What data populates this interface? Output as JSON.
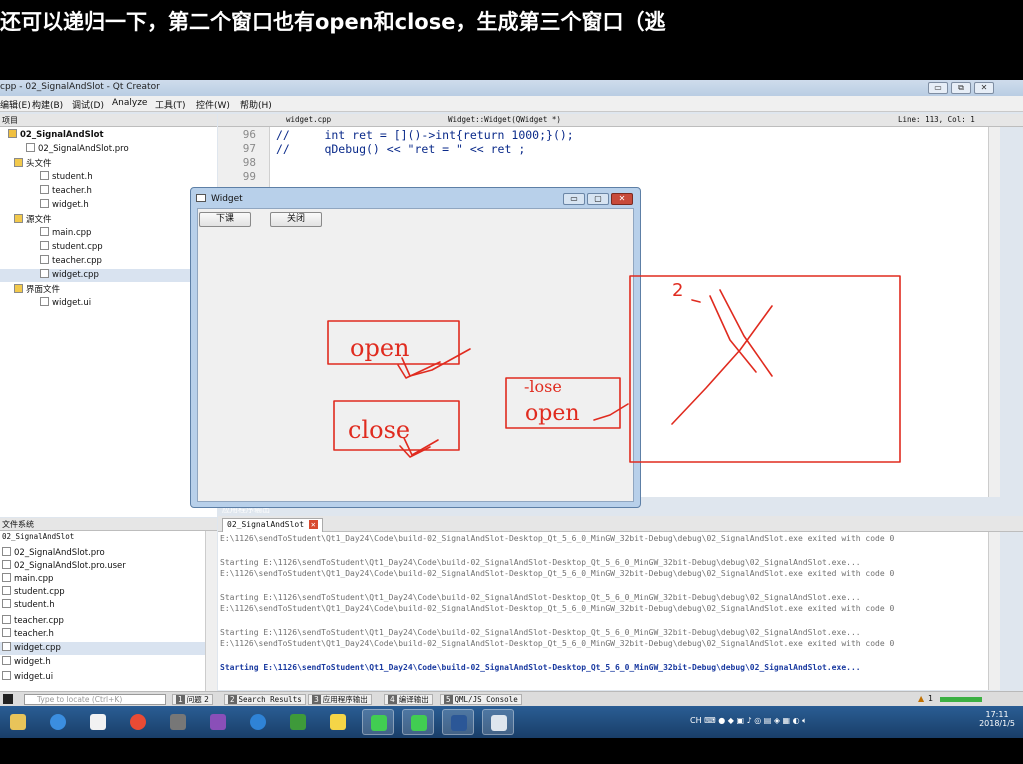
{
  "subtitle": "还可以递归一下，第二个窗口也有open和close，生成第三个窗口（逃",
  "window": {
    "title": "cpp - 02_SignalAndSlot - Qt Creator"
  },
  "menu": [
    "编辑(E)",
    "构建(B)",
    "调试(D)",
    "Analyze",
    "工具(T)",
    "控件(W)",
    "帮助(H)"
  ],
  "project_panel": {
    "header": "项目",
    "items": [
      {
        "label": "02_SignalAndSlot",
        "indent": 0
      },
      {
        "label": "02_SignalAndSlot.pro",
        "indent": 1
      },
      {
        "label": "头文件",
        "indent": 1
      },
      {
        "label": "student.h",
        "indent": 2
      },
      {
        "label": "teacher.h",
        "indent": 2
      },
      {
        "label": "widget.h",
        "indent": 2
      },
      {
        "label": "源文件",
        "indent": 1
      },
      {
        "label": "main.cpp",
        "indent": 2
      },
      {
        "label": "student.cpp",
        "indent": 2
      },
      {
        "label": "teacher.cpp",
        "indent": 2
      },
      {
        "label": "widget.cpp",
        "indent": 2
      },
      {
        "label": "界面文件",
        "indent": 1
      },
      {
        "label": "widget.ui",
        "indent": 2
      }
    ]
  },
  "editor": {
    "file_tab": "widget.cpp",
    "function": "Widget::Widget(QWidget *)",
    "position": "Line: 113, Col: 1",
    "lines": [
      {
        "num": "96",
        "code": "//     int ret = []()->int{return 1000;}();"
      },
      {
        "num": "97",
        "code": "//     qDebug() << \"ret = \" << ret ;"
      },
      {
        "num": "98",
        "code": ""
      },
      {
        "num": "99",
        "code": ""
      }
    ]
  },
  "filesystem_panel": {
    "header": "文件系统",
    "root": "02_SignalAndSlot",
    "items": [
      "02_SignalAndSlot.pro",
      "02_SignalAndSlot.pro.user",
      "main.cpp",
      "student.cpp",
      "student.h",
      "teacher.cpp",
      "teacher.h",
      "widget.cpp",
      "widget.h",
      "widget.ui"
    ]
  },
  "output_panel": {
    "title": "应用程序输出",
    "tab": "02_SignalAndSlot",
    "lines": [
      "E:\\1126\\sendToStudent\\Qt1_Day24\\Code\\build-02_SignalAndSlot-Desktop_Qt_5_6_0_MinGW_32bit-Debug\\debug\\02_SignalAndSlot.exe exited with code 0",
      "",
      "Starting E:\\1126\\sendToStudent\\Qt1_Day24\\Code\\build-02_SignalAndSlot-Desktop_Qt_5_6_0_MinGW_32bit-Debug\\debug\\02_SignalAndSlot.exe...",
      "E:\\1126\\sendToStudent\\Qt1_Day24\\Code\\build-02_SignalAndSlot-Desktop_Qt_5_6_0_MinGW_32bit-Debug\\debug\\02_SignalAndSlot.exe exited with code 0",
      "",
      "Starting E:\\1126\\sendToStudent\\Qt1_Day24\\Code\\build-02_SignalAndSlot-Desktop_Qt_5_6_0_MinGW_32bit-Debug\\debug\\02_SignalAndSlot.exe...",
      "E:\\1126\\sendToStudent\\Qt1_Day24\\Code\\build-02_SignalAndSlot-Desktop_Qt_5_6_0_MinGW_32bit-Debug\\debug\\02_SignalAndSlot.exe exited with code 0",
      "",
      "Starting E:\\1126\\sendToStudent\\Qt1_Day24\\Code\\build-02_SignalAndSlot-Desktop_Qt_5_6_0_MinGW_32bit-Debug\\debug\\02_SignalAndSlot.exe...",
      "E:\\1126\\sendToStudent\\Qt1_Day24\\Code\\build-02_SignalAndSlot-Desktop_Qt_5_6_0_MinGW_32bit-Debug\\debug\\02_SignalAndSlot.exe exited with code 0",
      "",
      "Starting E:\\1126\\sendToStudent\\Qt1_Day24\\Code\\build-02_SignalAndSlot-Desktop_Qt_5_6_0_MinGW_32bit-Debug\\debug\\02_SignalAndSlot.exe..."
    ]
  },
  "locator": {
    "placeholder": "Type to locate (Ctrl+K)",
    "tabs": [
      {
        "num": "1",
        "label": "问题",
        "badge": "2"
      },
      {
        "num": "2",
        "label": "Search Results"
      },
      {
        "num": "3",
        "label": "应用程序输出"
      },
      {
        "num": "4",
        "label": "编译输出"
      },
      {
        "num": "5",
        "label": "QML/JS Console"
      }
    ],
    "warning_count": "1"
  },
  "widget_window": {
    "title": "Widget",
    "btn1": "下课",
    "btn2": "关闭"
  },
  "annotations": {
    "open1": "open",
    "close1": "close",
    "open2": "open",
    "close_small": "-lose",
    "num": "2"
  },
  "taskbar": {
    "tray": "CH",
    "time": "17:11",
    "date": "2018/1/5"
  },
  "colors": {
    "ink": "#e02b1f",
    "taskbar": "#1f4b7e"
  }
}
